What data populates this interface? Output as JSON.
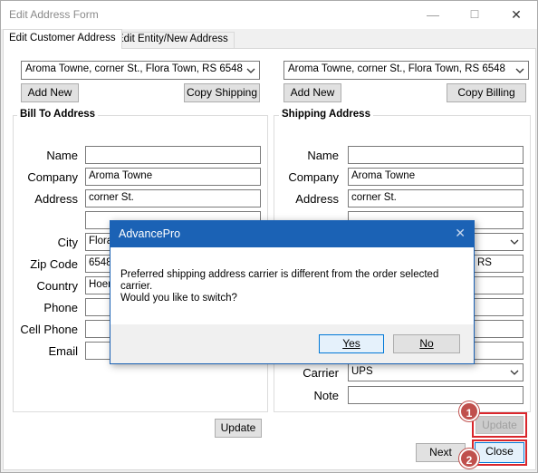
{
  "window": {
    "title": "Edit Address Form",
    "minimize_glyph": "—",
    "maximize_glyph": "☐",
    "close_glyph": "✕"
  },
  "tabs": [
    {
      "label": "Edit Customer Address",
      "active": true
    },
    {
      "label": "Edit Entity/New Address",
      "active": false
    }
  ],
  "bill_to": {
    "selector_value": "Aroma Towne, corner St., Flora Town, RS 6548",
    "add_new_label": "Add New",
    "copy_label": "Copy Shipping",
    "group_title": "Bill To Address",
    "fields": {
      "name": {
        "label": "Name",
        "value": ""
      },
      "company": {
        "label": "Company",
        "value": "Aroma Towne"
      },
      "address": {
        "label": "Address",
        "value": "corner St."
      },
      "address2": {
        "label": "",
        "value": ""
      },
      "city": {
        "label": "City",
        "value": "Flora"
      },
      "zip": {
        "label": "Zip Code",
        "value": "6548"
      },
      "country": {
        "label": "Country",
        "value": "Hoen"
      },
      "phone": {
        "label": "Phone",
        "value": ""
      },
      "cell": {
        "label": "Cell Phone",
        "value": ""
      },
      "email": {
        "label": "Email",
        "value": ""
      }
    },
    "update_label": "Update"
  },
  "shipping": {
    "selector_value": "Aroma Towne, corner St., Flora Town, RS 6548",
    "add_new_label": "Add New",
    "copy_label": "Copy Billing",
    "group_title": "Shipping Address",
    "fields": {
      "name": {
        "label": "Name",
        "value": ""
      },
      "company": {
        "label": "Company",
        "value": "Aroma Towne"
      },
      "address": {
        "label": "Address",
        "value": "corner St."
      },
      "address2": {
        "label": "",
        "value": ""
      },
      "state_value": "RS",
      "carrier": {
        "label": "Carrier",
        "value": "UPS"
      },
      "note": {
        "label": "Note",
        "value": ""
      }
    },
    "update_label": "Update"
  },
  "footer": {
    "next_label": "Next",
    "close_label": "Close"
  },
  "markers": {
    "one": "1",
    "two": "2"
  },
  "dialog": {
    "title": "AdvancePro",
    "close_glyph": "✕",
    "message_line1": "Preferred shipping address carrier is different from the order selected",
    "message_line2": "carrier.",
    "message_line3": "Would you like to switch?",
    "yes_label": "Yes",
    "no_label": "No"
  },
  "colors": {
    "dialog_accent": "#1b62b5",
    "marker": "#c0504d",
    "highlight": "#d9262c"
  }
}
